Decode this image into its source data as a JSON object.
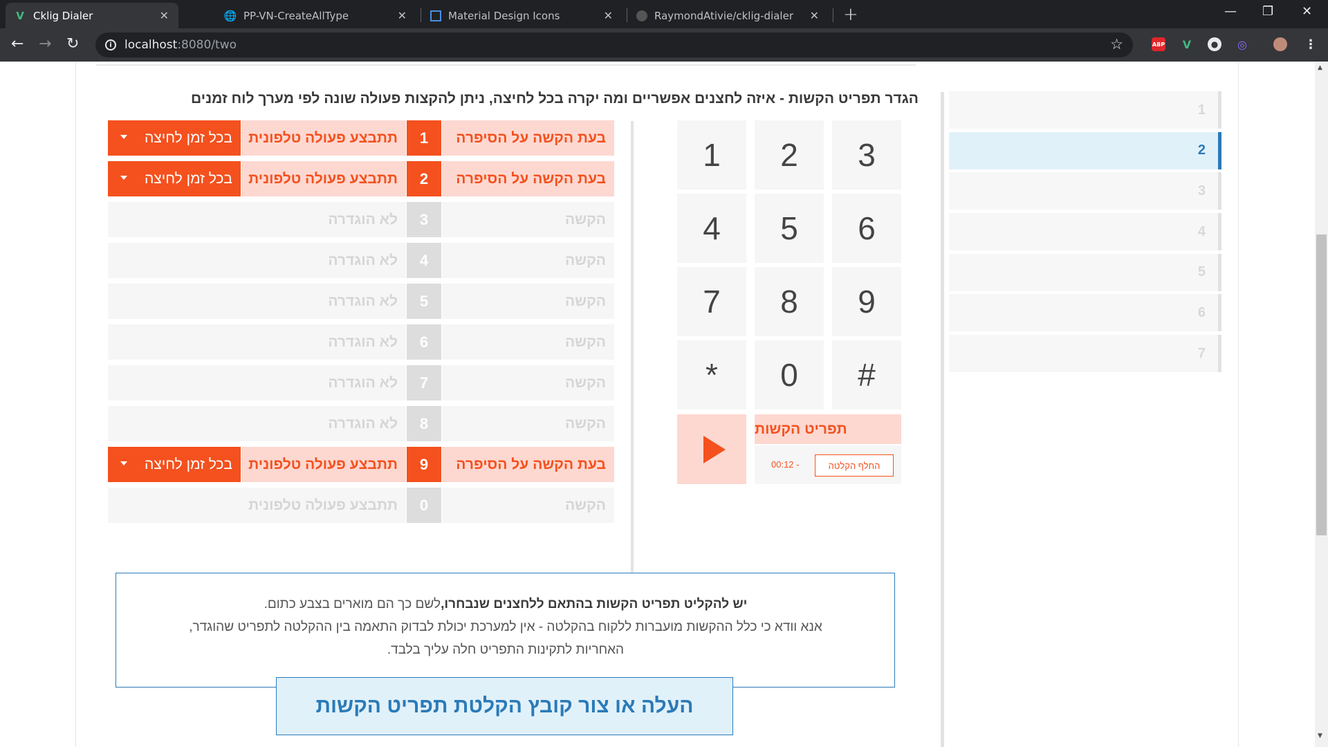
{
  "browser": {
    "tabs": [
      {
        "title": "Cklig Dialer",
        "favicon": "vue-icon",
        "active": true
      },
      {
        "title": "PP-VN-CreateAllType",
        "favicon": "globe-icon",
        "active": false
      },
      {
        "title": "Material Design Icons",
        "favicon": "mdi-icon",
        "active": false
      },
      {
        "title": "RaymondAtivie/cklig-dialer",
        "favicon": "github-icon",
        "active": false
      }
    ],
    "url_host": "localhost",
    "url_path": ":8080/two",
    "extensions": [
      "ABP",
      "V",
      "●",
      "◎"
    ]
  },
  "steps": [
    "1",
    "2",
    "3",
    "4",
    "5",
    "6",
    "7"
  ],
  "active_step": "2",
  "heading": "הגדר תפריט הקשות - איזה לחצנים אפשריים ומה יקרה בכל לחיצה, ניתן להקצות פעולה שונה לפי מערך לוח זמנים",
  "keypad": {
    "keys": [
      "1",
      "2",
      "3",
      "4",
      "5",
      "6",
      "7",
      "8",
      "9",
      "*",
      "0",
      "#"
    ],
    "recording_title": "תפריט הקשות",
    "replace_label": "החלף הקלטה",
    "time_label": "00:12 -"
  },
  "rows": [
    {
      "when": "בעת הקשה על הסיפרה",
      "digit": "1",
      "action": "תתבצע פעולה טלפונית",
      "timing": "בכל זמן לחיצה",
      "enabled": true
    },
    {
      "when": "בעת הקשה על הסיפרה",
      "digit": "2",
      "action": "תתבצע פעולה טלפונית",
      "timing": "בכל זמן לחיצה",
      "enabled": true
    },
    {
      "when": "הקשה",
      "digit": "3",
      "action": "לא הוגדרה",
      "timing": "",
      "enabled": false
    },
    {
      "when": "הקשה",
      "digit": "4",
      "action": "לא הוגדרה",
      "timing": "",
      "enabled": false
    },
    {
      "when": "הקשה",
      "digit": "5",
      "action": "לא הוגדרה",
      "timing": "",
      "enabled": false
    },
    {
      "when": "הקשה",
      "digit": "6",
      "action": "לא הוגדרה",
      "timing": "",
      "enabled": false
    },
    {
      "when": "הקשה",
      "digit": "7",
      "action": "לא הוגדרה",
      "timing": "",
      "enabled": false
    },
    {
      "when": "הקשה",
      "digit": "8",
      "action": "לא הוגדרה",
      "timing": "",
      "enabled": false
    },
    {
      "when": "בעת הקשה על הסיפרה",
      "digit": "9",
      "action": "תתבצע פעולה טלפונית",
      "timing": "בכל זמן לחיצה",
      "enabled": true
    },
    {
      "when": "הקשה",
      "digit": "0",
      "action": "תתבצע פעולה טלפונית",
      "timing": "",
      "enabled": false
    }
  ],
  "notice": {
    "bold": "יש להקליט תפריט הקשות בהתאם ללחצנים שנבחרו,",
    "line1_rest": "לשם כך הם מוארים בצבע כתום.",
    "line2": "אנא וודא כי כלל ההקשות מועברות ללקוח בהקלטה - אין למערכת יכולת לבדוק התאמה בין ההקלטה לתפריט שהוגדר,",
    "line3": "האחריות לתקינות התפריט חלה עליך בלבד."
  },
  "upload_label": "העלה או צור קובץ הקלטת תפריט הקשות",
  "colors": {
    "accent": "#f4511e",
    "accent_light": "#fdd8d1",
    "primary": "#2b7ab7",
    "primary_light": "#e1f1fa"
  }
}
